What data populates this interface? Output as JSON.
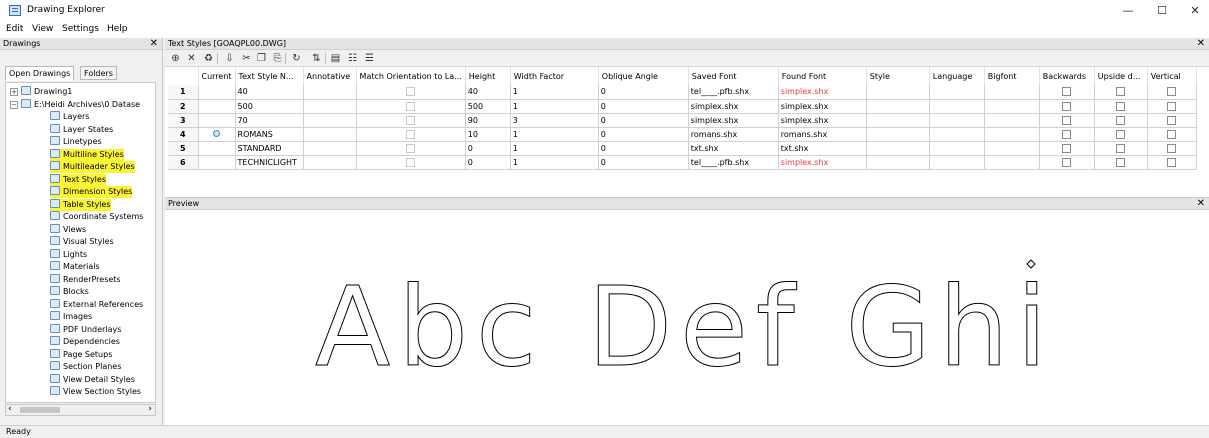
{
  "window": {
    "title": "Drawing Explorer",
    "buttons": [
      "—",
      "☐",
      "✕"
    ]
  },
  "menu": [
    "Edit",
    "View",
    "Settings",
    "Help"
  ],
  "drawings_panel": {
    "title": "Drawings",
    "close": "✕",
    "tabs": [
      "Open Drawings",
      "Folders"
    ],
    "tree": [
      {
        "label": "Drawing1",
        "expander": "+",
        "level": 0
      },
      {
        "label": "E:\\Heidi Archives\\0 Datase",
        "expander": "−",
        "level": 0
      },
      {
        "label": "Layers",
        "level": 1
      },
      {
        "label": "Layer States",
        "level": 1
      },
      {
        "label": "Linetypes",
        "level": 1
      },
      {
        "label": "Multiline Styles",
        "level": 1,
        "highlight": true
      },
      {
        "label": "Multileader Styles",
        "level": 1,
        "highlight": true
      },
      {
        "label": "Text Styles",
        "level": 1,
        "highlight": true
      },
      {
        "label": "Dimension Styles",
        "level": 1,
        "highlight": true
      },
      {
        "label": "Table Styles",
        "level": 1,
        "highlight": true
      },
      {
        "label": "Coordinate Systems",
        "level": 1
      },
      {
        "label": "Views",
        "level": 1
      },
      {
        "label": "Visual Styles",
        "level": 1
      },
      {
        "label": "Lights",
        "level": 1
      },
      {
        "label": "Materials",
        "level": 1
      },
      {
        "label": "RenderPresets",
        "level": 1
      },
      {
        "label": "Blocks",
        "level": 1
      },
      {
        "label": "External References",
        "level": 1
      },
      {
        "label": "Images",
        "level": 1
      },
      {
        "label": "PDF Underlays",
        "level": 1
      },
      {
        "label": "Dependencies",
        "level": 1
      },
      {
        "label": "Page Setups",
        "level": 1
      },
      {
        "label": "Section Planes",
        "level": 1
      },
      {
        "label": "View Detail Styles",
        "level": 1
      },
      {
        "label": "View Section Styles",
        "level": 1
      }
    ],
    "highlight_color": "#f9f533"
  },
  "text_styles_panel": {
    "title": "Text Styles [GOAQPL00.DWG]",
    "close": "✕",
    "toolbar_icons": [
      "new-icon",
      "delete-icon",
      "purge-icon",
      "import-icon",
      "cut-icon",
      "copy-icon",
      "paste-icon",
      "refresh-icon",
      "sort-icon",
      "details-view-icon",
      "large-icons-icon",
      "list-view-icon"
    ],
    "columns": [
      "",
      "Current",
      "Text Style N...",
      "Annotative",
      "Match Orientation to La...",
      "Height",
      "Width Factor",
      "Oblique Angle",
      "Saved Font",
      "Found Font",
      "Style",
      "Language",
      "Bigfont",
      "Backwards",
      "Upside d...",
      "Vertical"
    ],
    "rows": [
      {
        "n": "1",
        "current": false,
        "name": "40",
        "height": "40",
        "width": "1",
        "oblique": "0",
        "saved": "tel____.pfb.shx",
        "found": "simplex.shx",
        "found_missing": true
      },
      {
        "n": "2",
        "current": false,
        "name": "500",
        "height": "500",
        "width": "1",
        "oblique": "0",
        "saved": "simplex.shx",
        "found": "simplex.shx",
        "found_missing": false
      },
      {
        "n": "3",
        "current": false,
        "name": "70",
        "height": "90",
        "width": "3",
        "oblique": "0",
        "saved": "simplex.shx",
        "found": "simplex.shx",
        "found_missing": false
      },
      {
        "n": "4",
        "current": true,
        "name": "ROMANS",
        "height": "10",
        "width": "1",
        "oblique": "0",
        "saved": "romans.shx",
        "found": "romans.shx",
        "found_missing": false
      },
      {
        "n": "5",
        "current": false,
        "name": "STANDARD",
        "height": "0",
        "width": "1",
        "oblique": "0",
        "saved": "txt.shx",
        "found": "txt.shx",
        "found_missing": false
      },
      {
        "n": "6",
        "current": false,
        "name": "TECHNICLIGHT",
        "height": "0",
        "width": "1",
        "oblique": "0",
        "saved": "tel____.pfb.shx",
        "found": "simplex.shx",
        "found_missing": true
      }
    ],
    "missing_font_color": "#e83a3a"
  },
  "preview_panel": {
    "title": "Preview",
    "close": "✕",
    "sample_text": "Abc  Def  Ghi"
  },
  "status": "Ready"
}
